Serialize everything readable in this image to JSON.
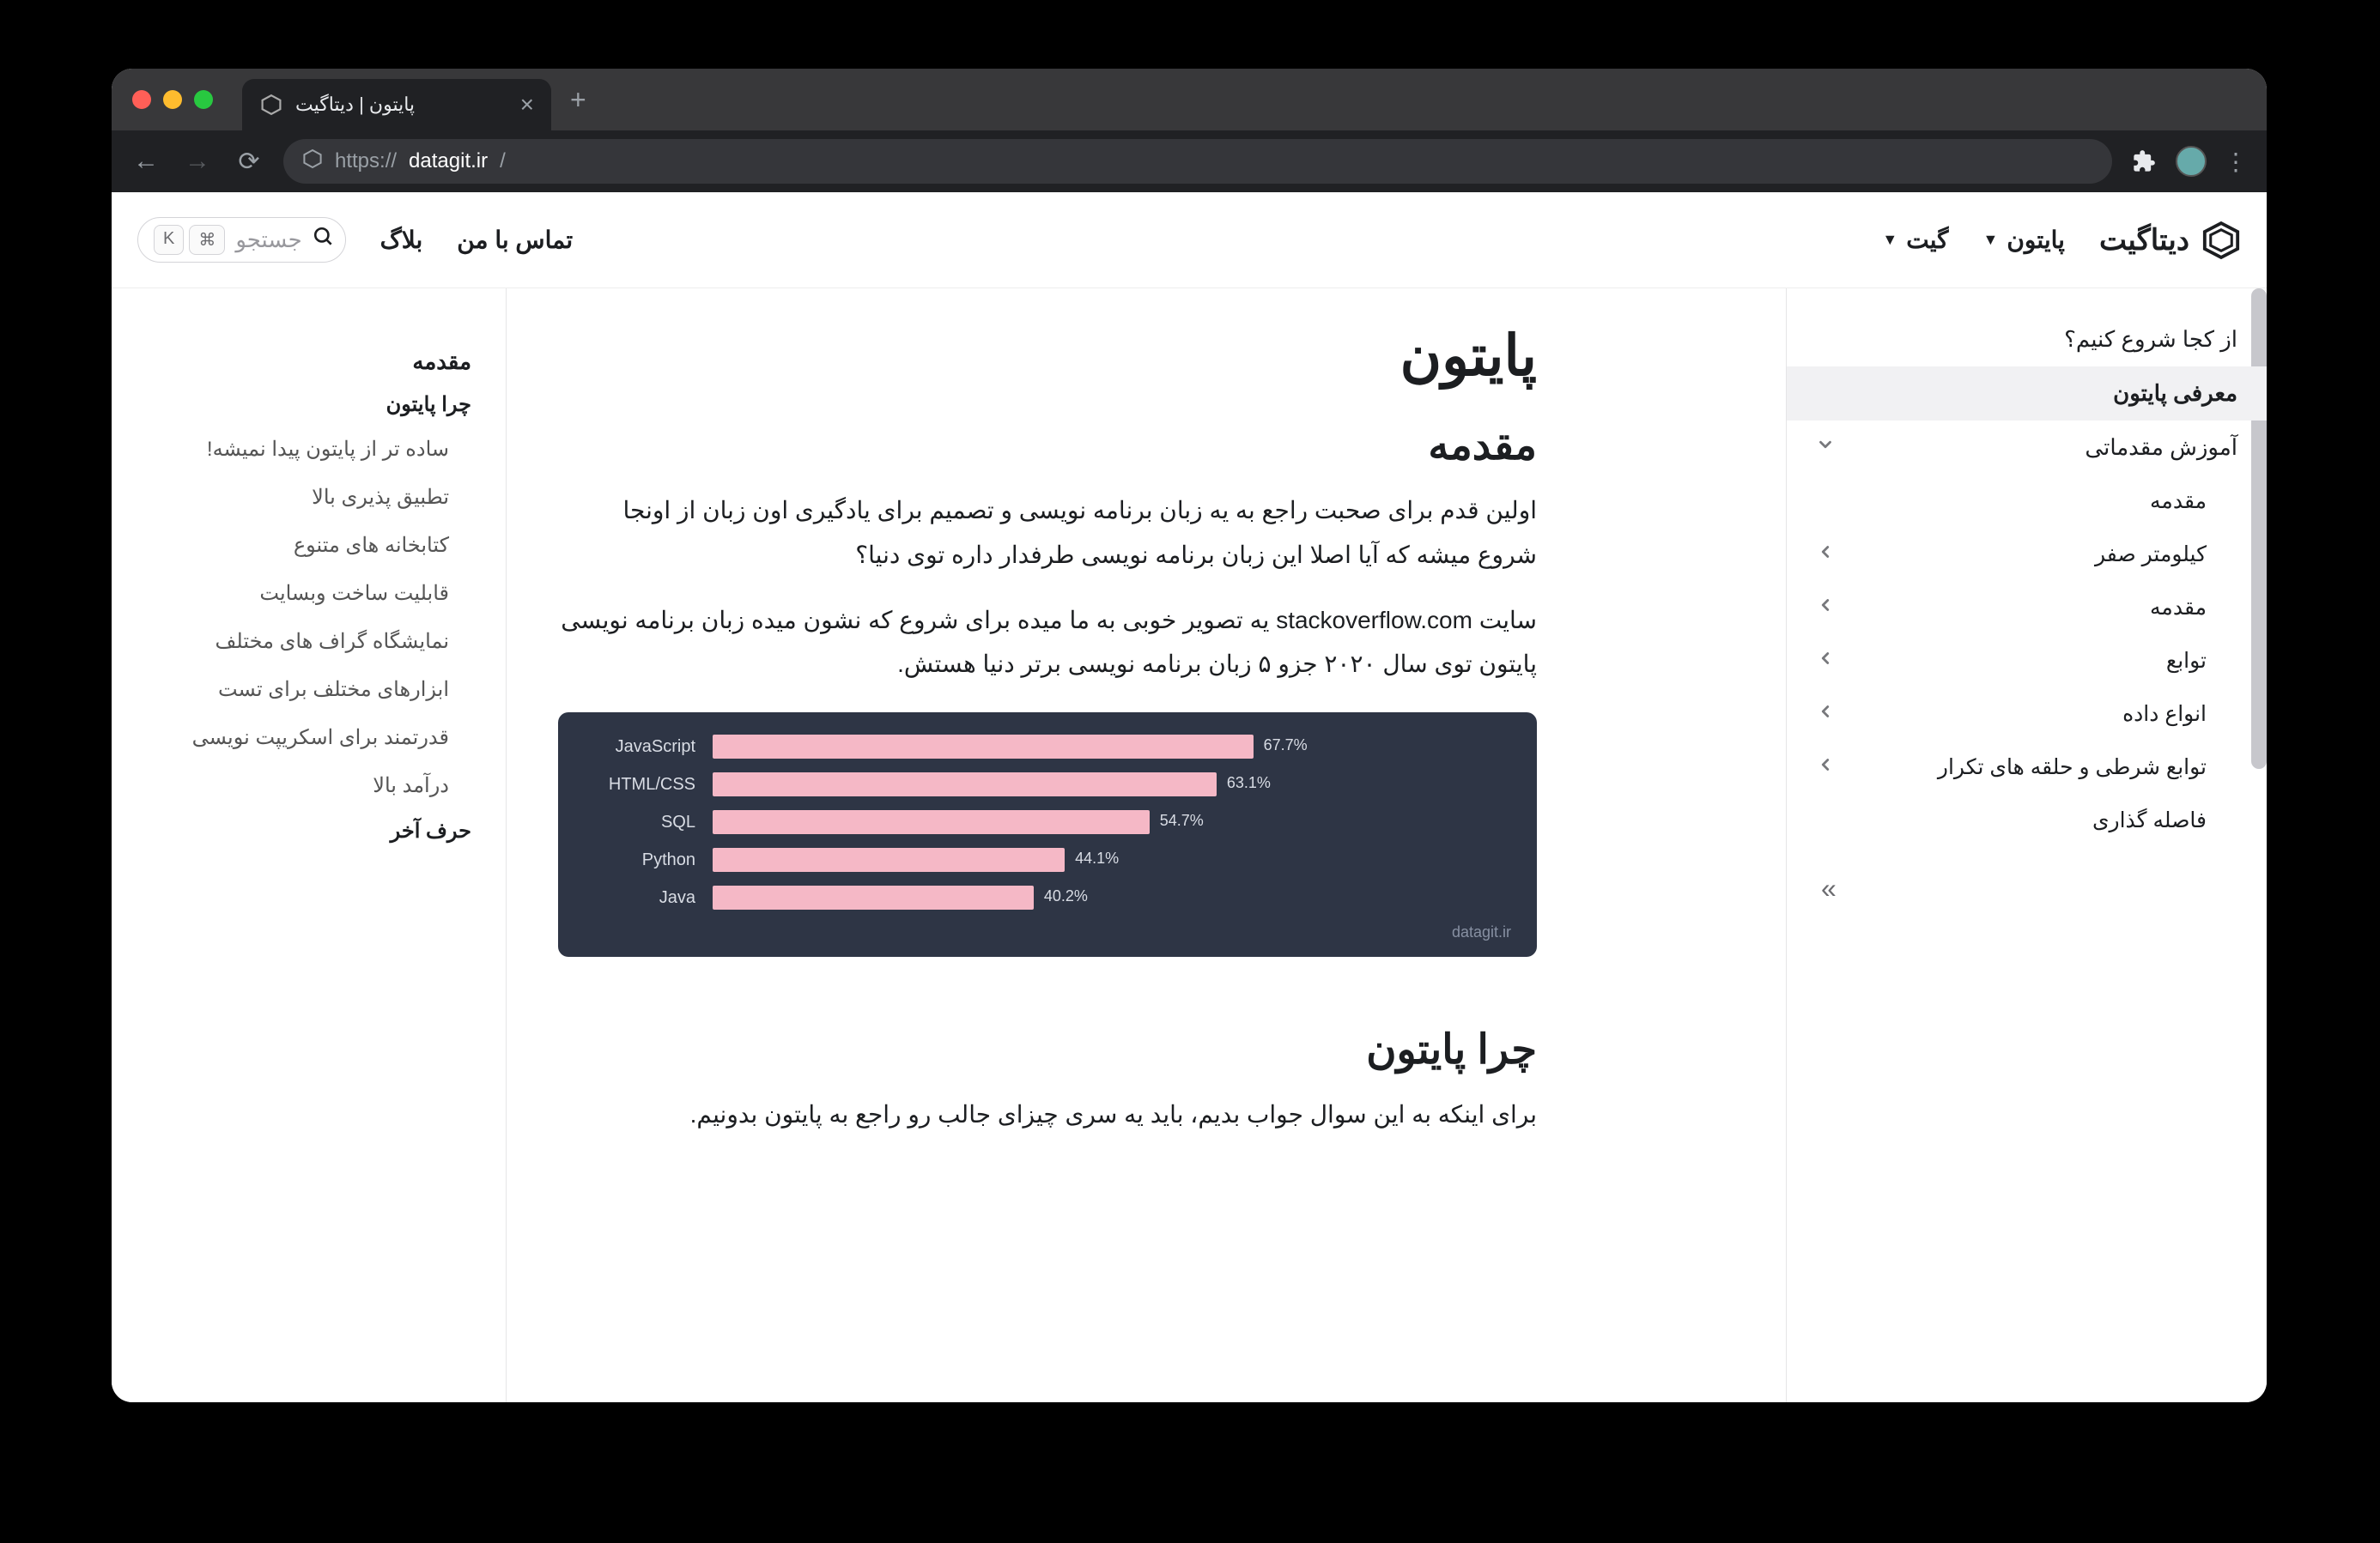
{
  "browser": {
    "tab_title": "پایتون | دیتاگیت",
    "url_scheme": "https://",
    "url_domain": "datagit.ir",
    "url_path": "/"
  },
  "header": {
    "brand": "دیتاگیت",
    "nav_python": "پایتون",
    "nav_git": "گیت",
    "nav_contact": "تماس با من",
    "nav_blog": "بلاگ",
    "search_placeholder": "جستجو",
    "kbd_cmd": "⌘",
    "kbd_k": "K"
  },
  "sidebar": {
    "items": [
      {
        "label": "از کجا شروع کنیم؟",
        "level": 0
      },
      {
        "label": "معرفی پایتون",
        "level": 0,
        "active": true
      },
      {
        "label": "آموزش مقدماتی",
        "level": 0,
        "expandable": true,
        "open": true
      },
      {
        "label": "مقدمه",
        "level": 1
      },
      {
        "label": "کیلومتر صفر",
        "level": 1,
        "expandable": true
      },
      {
        "label": "مقدمه",
        "level": 1,
        "expandable": true
      },
      {
        "label": "توابع",
        "level": 1,
        "expandable": true
      },
      {
        "label": "انواع داده",
        "level": 1,
        "expandable": true
      },
      {
        "label": "توابع شرطی و حلقه های تکرار",
        "level": 1,
        "expandable": true
      },
      {
        "label": "فاصله گذاری",
        "level": 1
      }
    ],
    "collapse_glyph": "»"
  },
  "article": {
    "title": "پایتون",
    "h2_intro": "مقدمه",
    "p1": "اولین قدم برای صحبت راجع به یه زبان برنامه نویسی و تصمیم برای یادگیری اون زبان از اونجا شروع میشه که آیا اصلا این زبان برنامه نویسی طرفدار داره توی دنیا؟",
    "p2": "سایت stackoverflow.com یه تصویر خوبی به ما میده برای شروع که نشون میده زبان برنامه نویسی پایتون توی سال ۲۰۲۰ جزو ۵ زبان برنامه نویسی برتر دنیا هستش.",
    "h2_why": "چرا پایتون",
    "p3": "برای اینکه به این سوال جواب بدیم، باید یه سری چیزای جالب رو راجع به پایتون بدونیم."
  },
  "chart_data": {
    "type": "bar",
    "orientation": "horizontal",
    "title": "",
    "xlabel": "",
    "ylabel": "",
    "xlim": [
      0,
      100
    ],
    "series": [
      {
        "name": "JavaScript",
        "value": 67.7
      },
      {
        "name": "HTML/CSS",
        "value": 63.1
      },
      {
        "name": "SQL",
        "value": 54.7
      },
      {
        "name": "Python",
        "value": 44.1
      },
      {
        "name": "Java",
        "value": 40.2
      }
    ],
    "watermark": "datagit.ir"
  },
  "toc": {
    "items": [
      {
        "label": "مقدمه",
        "level": 0
      },
      {
        "label": "چرا پایتون",
        "level": 1
      },
      {
        "label": "ساده تر از پایتون پیدا نمیشه!",
        "level": 2
      },
      {
        "label": "تطبیق پذیری بالا",
        "level": 2
      },
      {
        "label": "کتابخانه های متنوع",
        "level": 2
      },
      {
        "label": "قابلیت ساخت وبسایت",
        "level": 2
      },
      {
        "label": "نمایشگاه گراف های مختلف",
        "level": 2
      },
      {
        "label": "ابزارهای مختلف برای تست",
        "level": 2
      },
      {
        "label": "قدرتمند برای اسکریپت نویسی",
        "level": 2
      },
      {
        "label": "درآمد بالا",
        "level": 2
      },
      {
        "label": "حرف آخر",
        "level": "last"
      }
    ]
  }
}
